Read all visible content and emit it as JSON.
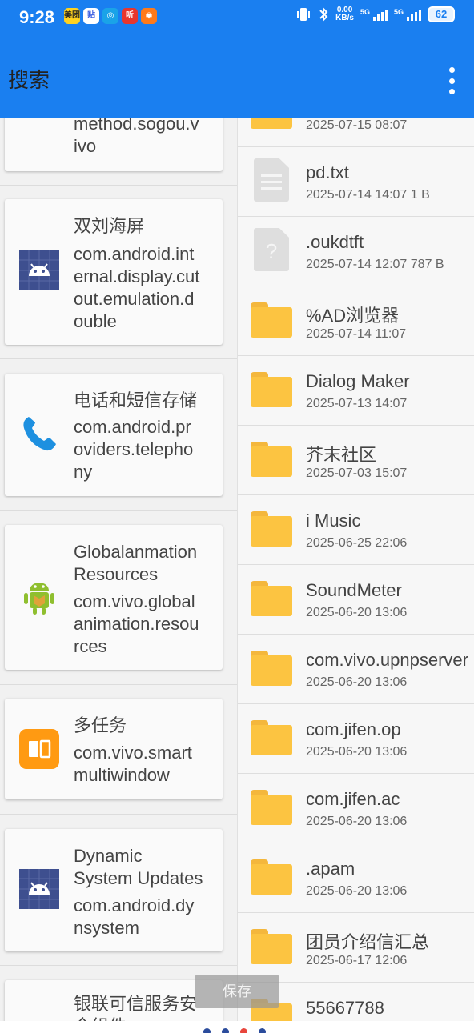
{
  "status_bar": {
    "time": "9:28",
    "app_icons": [
      "meituan-icon",
      "tieba-icon",
      "chat-icon",
      "ting-icon",
      "weibo-icon"
    ],
    "app_icon_labels": [
      "美团",
      "贴",
      "",
      "听",
      ""
    ],
    "net_speed_value": "0.00",
    "net_speed_unit": "KB/s",
    "signal1_label": "5G",
    "signal2_label": "5G",
    "battery": "62"
  },
  "toolbar": {
    "search_placeholder": "搜索",
    "menu_icon": "more-vert-icon"
  },
  "apps": [
    {
      "name": "",
      "package": "method.sogou.vivo",
      "package_lines": [
        "method.sogou.v",
        "ivo"
      ],
      "icon": "input-method-icon"
    },
    {
      "name": "双刘海屏",
      "package_lines": [
        "com.android.int",
        "ernal.display.cut",
        "out.emulation.d",
        "ouble"
      ],
      "icon": "android-icon"
    },
    {
      "name": "电话和短信存储",
      "package_lines": [
        "com.android.pr",
        "oviders.telepho",
        "ny"
      ],
      "icon": "phone-icon"
    },
    {
      "name_lines": [
        "Globalanmation",
        "Resources"
      ],
      "package_lines": [
        "com.vivo.global",
        "animation.resou",
        "rces"
      ],
      "icon": "android-robot-icon"
    },
    {
      "name": "多任务",
      "package_lines": [
        "com.vivo.smart",
        "multiwindow"
      ],
      "icon": "multitask-icon"
    },
    {
      "name_lines": [
        "Dynamic",
        "System Updates"
      ],
      "package_lines": [
        "com.android.dy",
        "nsystem"
      ],
      "icon": "android-icon"
    },
    {
      "name_lines": [
        "银联可信服务安",
        "全组件"
      ],
      "icon": ""
    }
  ],
  "files": [
    {
      "name": "",
      "meta": "2025-07-15 08:07",
      "icon": "folder-icon"
    },
    {
      "name": "pd.txt",
      "meta": "2025-07-14 14:07 1 B",
      "icon": "text-file-icon"
    },
    {
      "name": ".oukdtft",
      "meta": "2025-07-14 12:07 787 B",
      "icon": "unknown-file-icon"
    },
    {
      "name": "%AD浏览器",
      "meta": "2025-07-14 11:07",
      "icon": "folder-icon"
    },
    {
      "name": "Dialog Maker",
      "meta": "2025-07-13 14:07",
      "icon": "folder-icon"
    },
    {
      "name": "芥末社区",
      "meta": "2025-07-03 15:07",
      "icon": "folder-icon"
    },
    {
      "name": "i Music",
      "meta": "2025-06-25 22:06",
      "icon": "folder-icon"
    },
    {
      "name": "SoundMeter",
      "meta": "2025-06-20 13:06",
      "icon": "folder-icon"
    },
    {
      "name": "com.vivo.upnpserver",
      "meta": "2025-06-20 13:06",
      "icon": "folder-icon"
    },
    {
      "name": "com.jifen.op",
      "meta": "2025-06-20 13:06",
      "icon": "folder-icon"
    },
    {
      "name": "com.jifen.ac",
      "meta": "2025-06-20 13:06",
      "icon": "folder-icon"
    },
    {
      "name": ".apam",
      "meta": "2025-06-20 13:06",
      "icon": "folder-icon"
    },
    {
      "name": "团员介绍信汇总",
      "meta": "2025-06-17 12:06",
      "icon": "folder-icon"
    },
    {
      "name": "55667788",
      "meta": "",
      "icon": "folder-icon"
    }
  ],
  "save_button": "保存",
  "colors": {
    "primary": "#1a7ff0",
    "folder": "#fcc441",
    "page_indicator_active": "#e8453c",
    "page_indicator": "#2b4c9c"
  }
}
